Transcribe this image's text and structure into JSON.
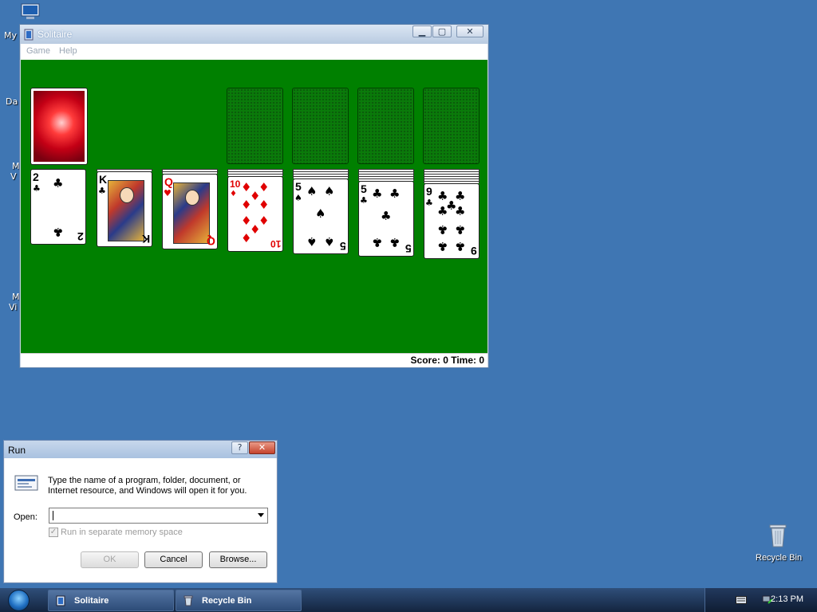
{
  "desktop": {
    "icons": [
      {
        "label": "My"
      },
      {
        "label": "Da"
      },
      {
        "label": "M"
      },
      {
        "label": "V"
      },
      {
        "label": "M"
      },
      {
        "label": "Vi"
      }
    ],
    "recycle_bin": {
      "label": "Recycle Bin"
    }
  },
  "solitaire": {
    "title": "Solitaire",
    "menu": [
      "Game",
      "Help"
    ],
    "status": "Score: 0  Time: 0",
    "tableau": [
      {
        "rank": "2",
        "suit": "♣",
        "color": "black"
      },
      {
        "rank": "K",
        "suit": "♣",
        "color": "black"
      },
      {
        "rank": "Q",
        "suit": "♥",
        "color": "red"
      },
      {
        "rank": "10",
        "suit": "♦",
        "color": "red"
      },
      {
        "rank": "5",
        "suit": "♠",
        "color": "black"
      },
      {
        "rank": "5",
        "suit": "♣",
        "color": "black"
      },
      {
        "rank": "9",
        "suit": "♣",
        "color": "black"
      }
    ]
  },
  "run_dialog": {
    "title": "Run",
    "help_label": "?",
    "close_label": "✕",
    "description": "Type the name of a program, folder, document, or Internet resource, and Windows will open it for you.",
    "open_label": "Open:",
    "open_value": "",
    "separate_memory_label": "Run in separate memory space",
    "ok_label": "OK",
    "cancel_label": "Cancel",
    "browse_label": "Browse..."
  },
  "taskbar": {
    "buttons": [
      {
        "label": "Solitaire"
      },
      {
        "label": "Recycle Bin"
      }
    ],
    "clock": "2:13 PM"
  }
}
